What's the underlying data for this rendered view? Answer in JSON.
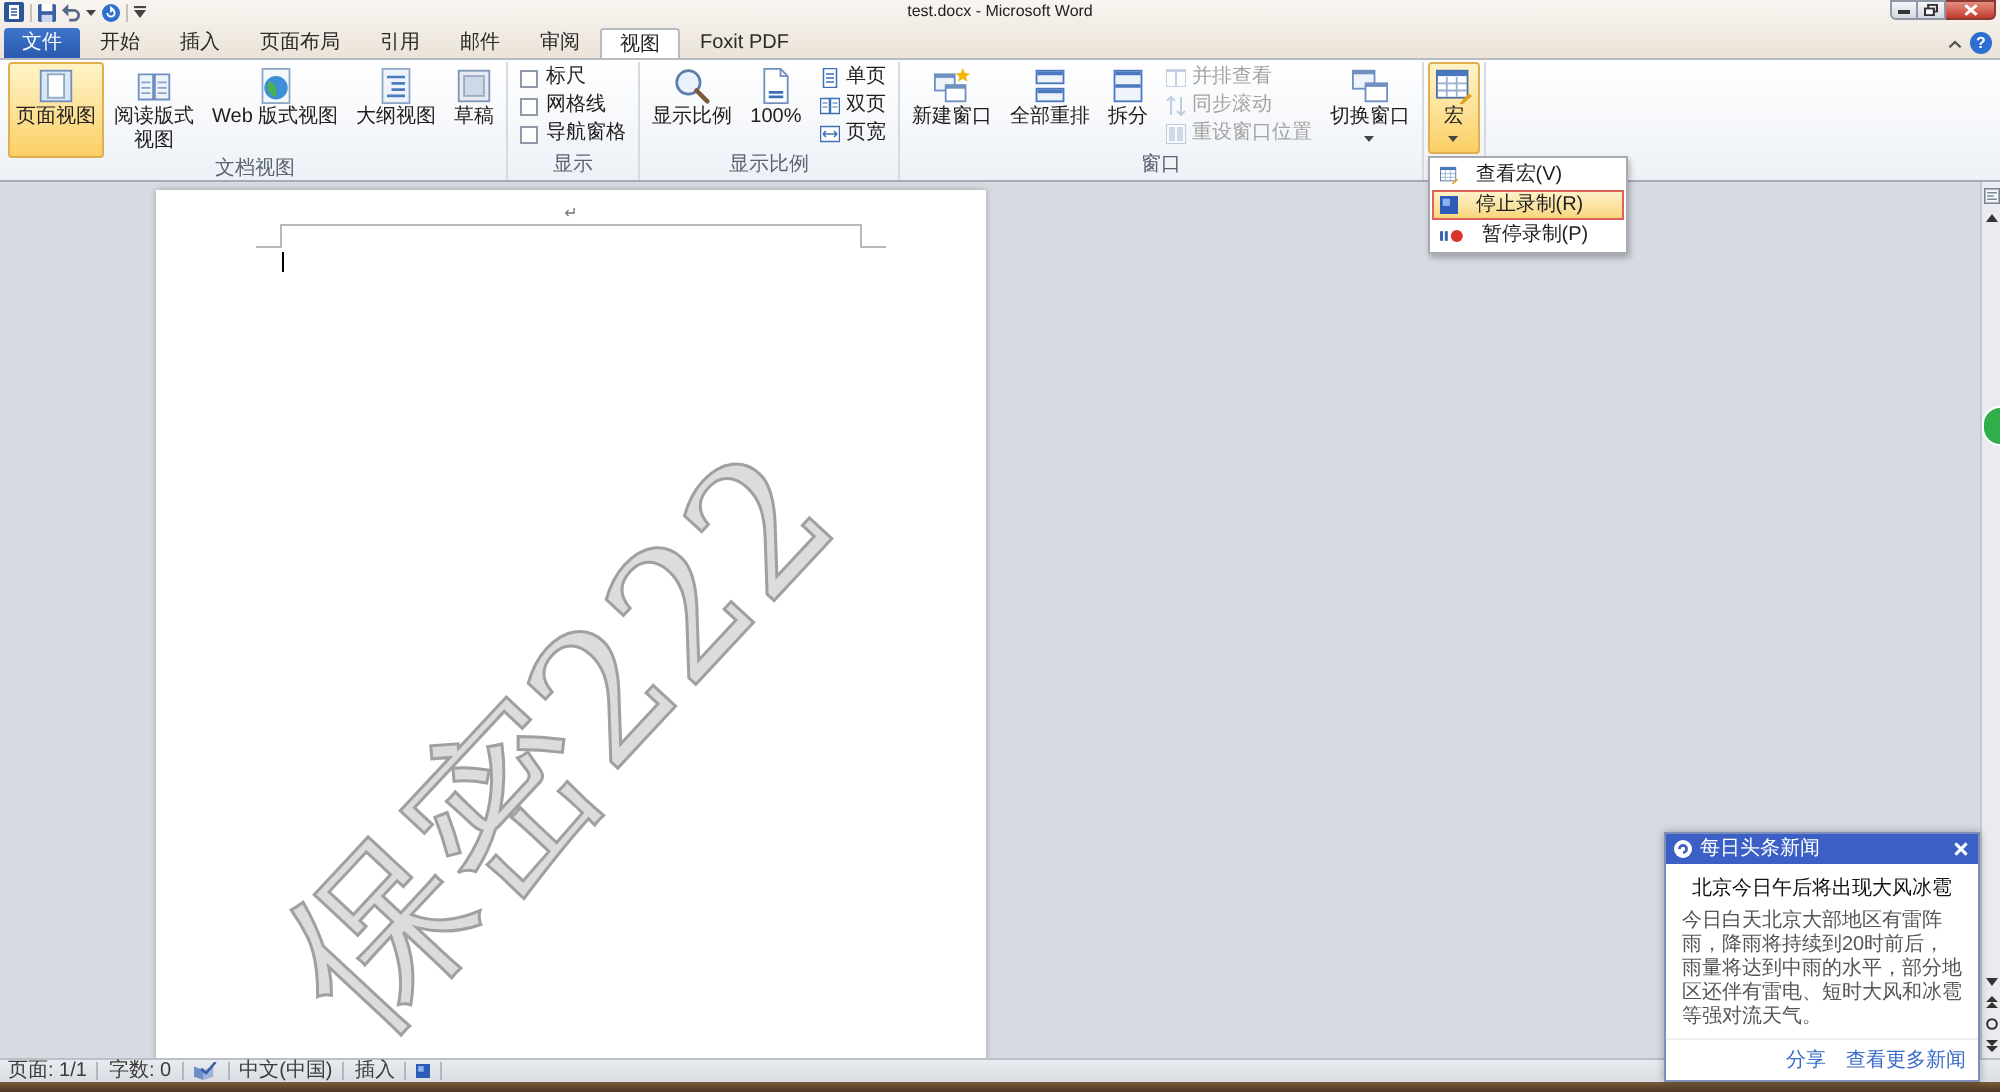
{
  "title_bar": {
    "title": "test.docx - Microsoft Word",
    "help_button": "?"
  },
  "tabs": [
    {
      "label": "文件",
      "kind": "file",
      "selected": false
    },
    {
      "label": "开始",
      "kind": "tab",
      "selected": false
    },
    {
      "label": "插入",
      "kind": "tab",
      "selected": false
    },
    {
      "label": "页面布局",
      "kind": "tab",
      "selected": false
    },
    {
      "label": "引用",
      "kind": "tab",
      "selected": false
    },
    {
      "label": "邮件",
      "kind": "tab",
      "selected": false
    },
    {
      "label": "审阅",
      "kind": "tab",
      "selected": false
    },
    {
      "label": "视图",
      "kind": "tab",
      "selected": true
    },
    {
      "label": "Foxit PDF",
      "kind": "tab",
      "selected": false
    }
  ],
  "ribbon": {
    "groups": [
      {
        "label": "文档视图",
        "items": [
          {
            "kind": "large",
            "label": "页面视图",
            "selected": true
          },
          {
            "kind": "large",
            "label": "阅读版式",
            "label_line_2": "视图",
            "selected": false
          },
          {
            "kind": "large",
            "label": "Web 版式视图",
            "selected": false
          },
          {
            "kind": "large",
            "label": "大纲视图",
            "selected": false
          },
          {
            "kind": "large",
            "label": "草稿",
            "selected": false
          }
        ]
      },
      {
        "label": "显示",
        "items": [
          {
            "kind": "stack",
            "items": [
              {
                "kind": "check",
                "label": "标尺",
                "checked": false
              },
              {
                "kind": "check",
                "label": "网格线",
                "checked": false
              },
              {
                "kind": "check",
                "label": "导航窗格",
                "checked": false
              }
            ]
          }
        ]
      },
      {
        "label": "显示比例",
        "items": [
          {
            "kind": "large",
            "label": "显示比例"
          },
          {
            "kind": "large",
            "label": "100%"
          },
          {
            "kind": "stack",
            "items": [
              {
                "kind": "small",
                "label": "单页",
                "disabled": false
              },
              {
                "kind": "small",
                "label": "双页",
                "disabled": false
              },
              {
                "kind": "small",
                "label": "页宽",
                "disabled": false
              }
            ]
          }
        ]
      },
      {
        "label": "窗口",
        "items": [
          {
            "kind": "large",
            "label": "新建窗口"
          },
          {
            "kind": "large",
            "label": "全部重排"
          },
          {
            "kind": "large",
            "label": "拆分"
          },
          {
            "kind": "stack",
            "items": [
              {
                "kind": "small",
                "label": "并排查看",
                "disabled": true
              },
              {
                "kind": "small",
                "label": "同步滚动",
                "disabled": true
              },
              {
                "kind": "small",
                "label": "重设窗口位置",
                "disabled": true
              }
            ]
          },
          {
            "kind": "large",
            "label": "切换窗口",
            "dropdown": true
          }
        ]
      },
      {
        "items": [
          {
            "kind": "large",
            "label": "宏",
            "dropdown": true,
            "expanded": true
          }
        ]
      }
    ]
  },
  "macro_menu": {
    "items": [
      {
        "label": "查看宏(V)",
        "selected": false
      },
      {
        "label": "停止录制(R)",
        "selected": true
      },
      {
        "label": "暂停录制(P)",
        "selected": false
      }
    ]
  },
  "document": {
    "paragraph_mark": "↵",
    "watermark": "保密222"
  },
  "status_bar": {
    "page": "页面: 1/1",
    "words": "字数: 0",
    "language": "中文(中国)",
    "mode": "插入"
  },
  "news_popup": {
    "source": "每日头条新闻",
    "headline": "北京今日午后将出现大风冰雹",
    "body": "今日白天北京大部地区有雷阵雨，降雨将持续到20时前后，雨量将达到中雨的水平，部分地区还伴有雷电、短时大风和冰雹等强对流天气。",
    "links": [
      "分享",
      "查看更多新闻"
    ]
  }
}
